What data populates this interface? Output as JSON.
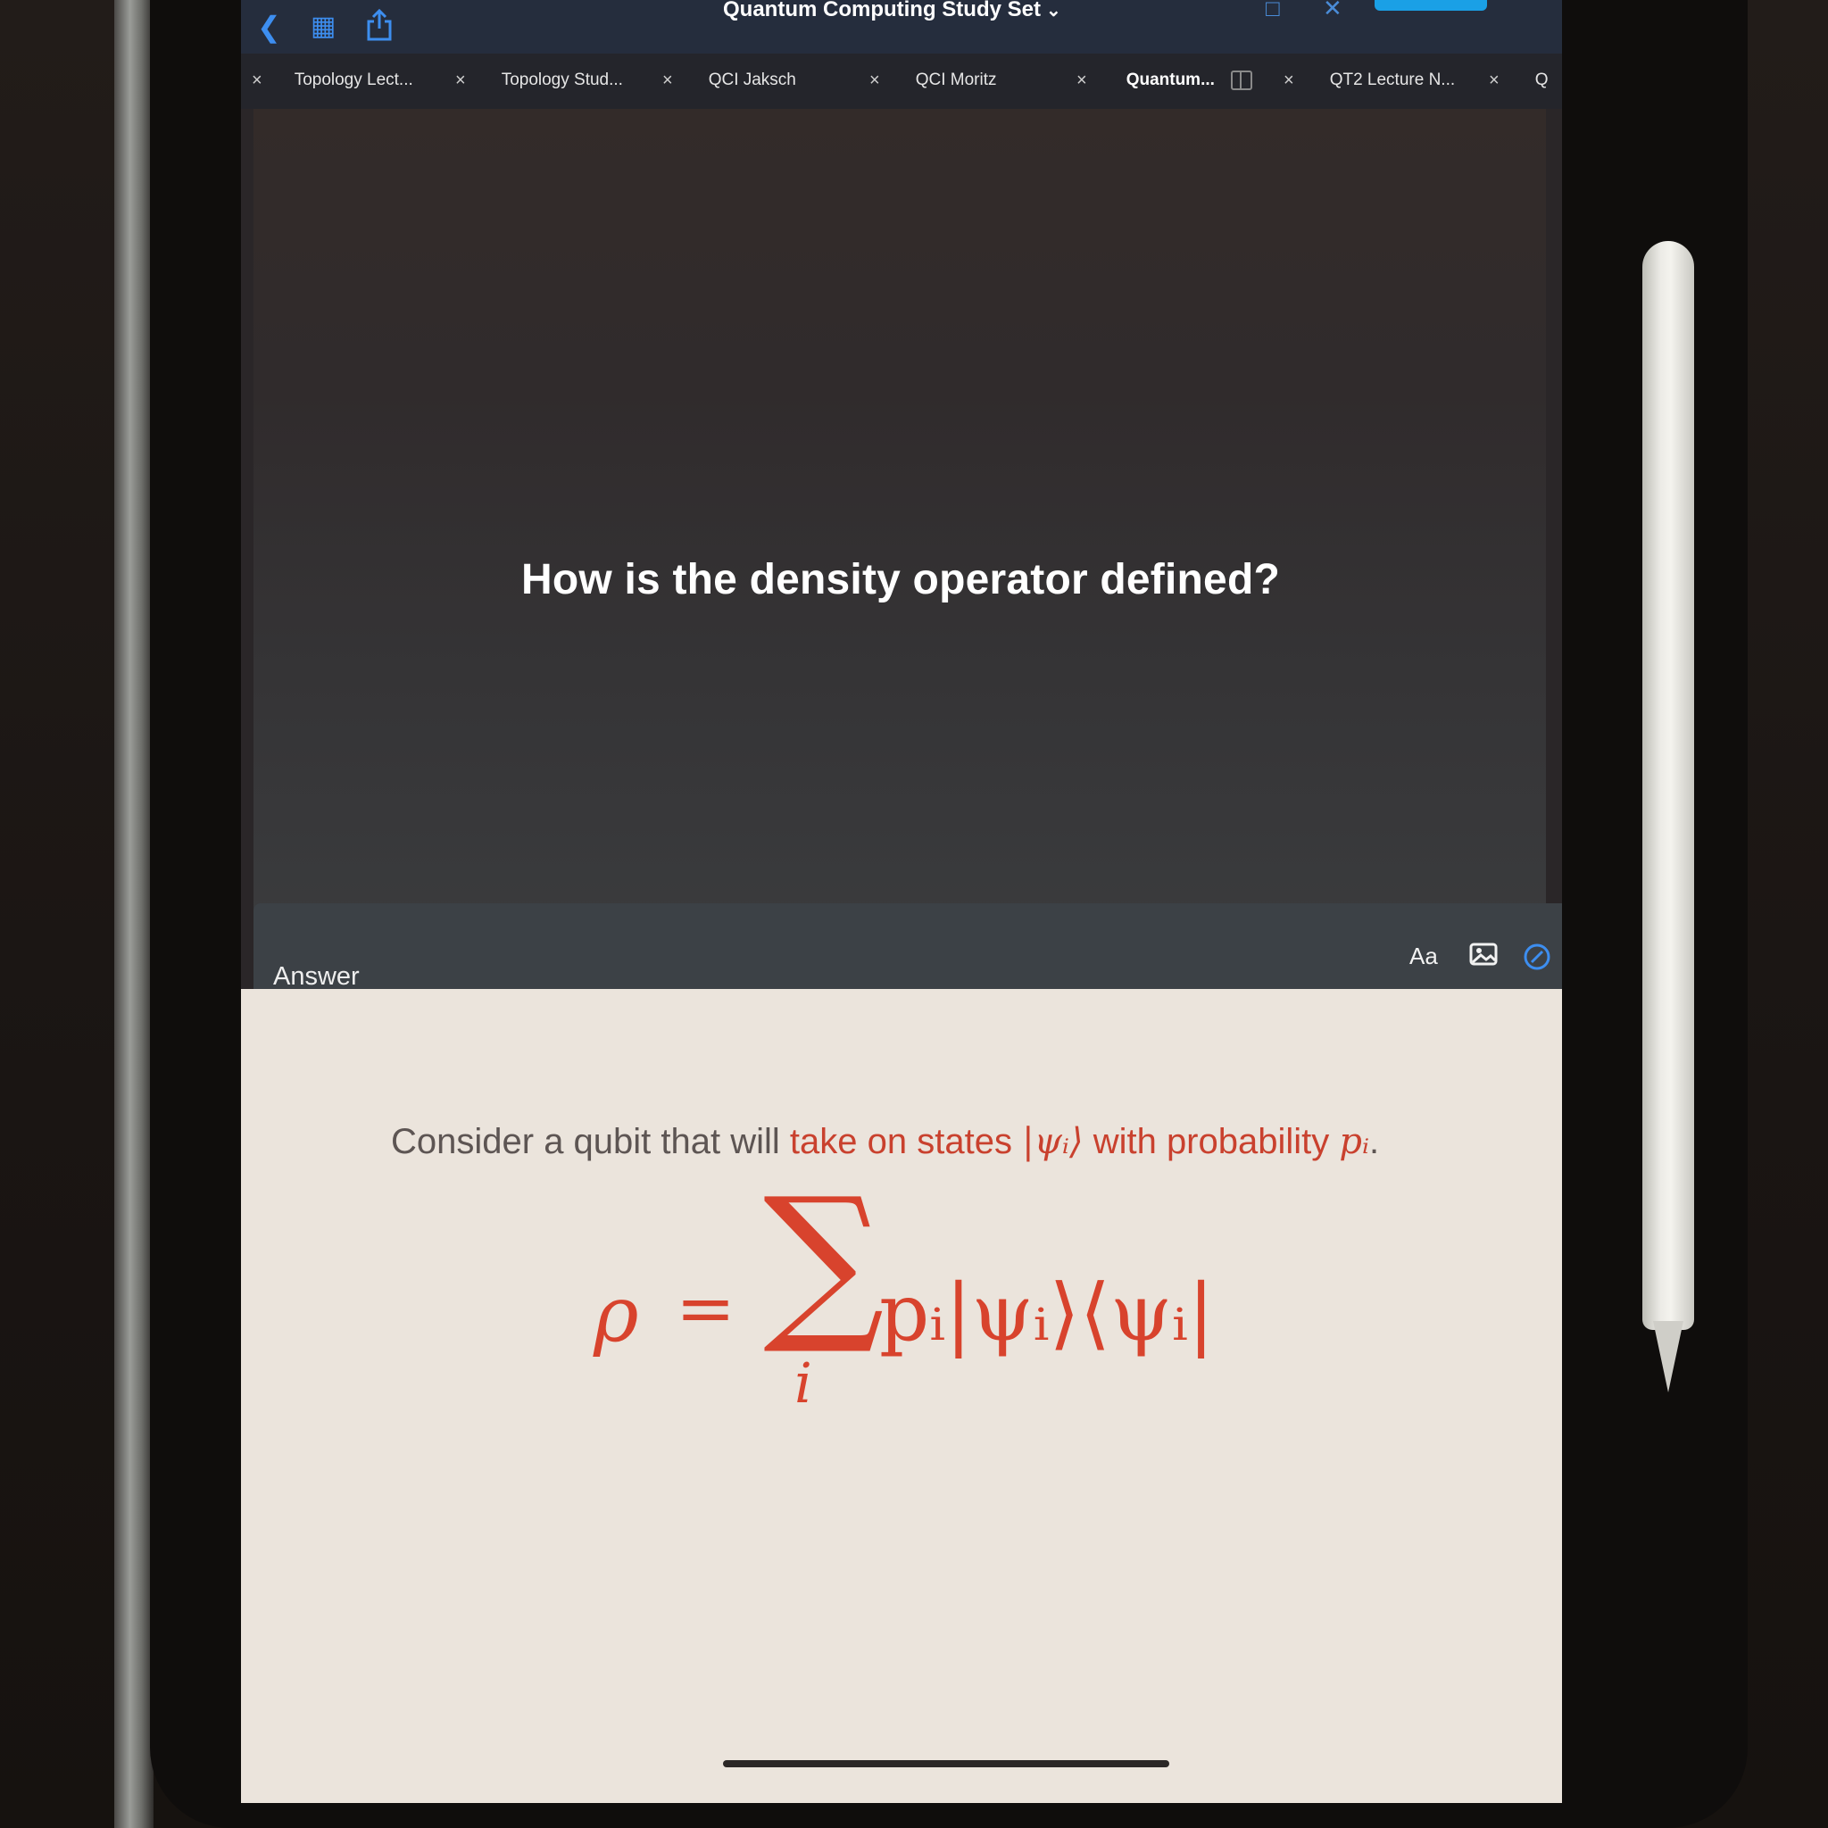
{
  "topbar": {
    "title": "Quantum Computing Study Set",
    "back_icon": "chevron-left-icon",
    "grid_icon": "grid-icon",
    "share_icon": "share-icon"
  },
  "tabs": [
    {
      "label": "Topology Lect...",
      "active": false
    },
    {
      "label": "Topology Stud...",
      "active": false
    },
    {
      "label": "QCI Jaksch",
      "active": false
    },
    {
      "label": "QCI Moritz",
      "active": false
    },
    {
      "label": "Quantum...",
      "active": true
    },
    {
      "label": "QT2 Lecture N...",
      "active": false
    },
    {
      "label": "Q",
      "active": false
    }
  ],
  "question": {
    "text": "How is the density operator defined?"
  },
  "answer": {
    "label": "Answer",
    "font_button": "Aa",
    "image_icon": "image-icon",
    "pen_icon": "pencil-circle-icon",
    "sentence_prefix": "Consider a qubit that will ",
    "sentence_highlight": "take on states",
    "sentence_ket": "|ψᵢ⟩",
    "sentence_middle": " with probability ",
    "sentence_prob": "pᵢ",
    "sentence_end": ".",
    "formula": {
      "lhs": "ρ",
      "equals": "=",
      "sum": "∑",
      "index": "i",
      "rhs": "pᵢ|ψᵢ⟩⟨ψᵢ|"
    }
  },
  "colors": {
    "accent": "#3d8ef0",
    "highlight": "#c9412e",
    "answer_bg": "#ebe4dc"
  }
}
